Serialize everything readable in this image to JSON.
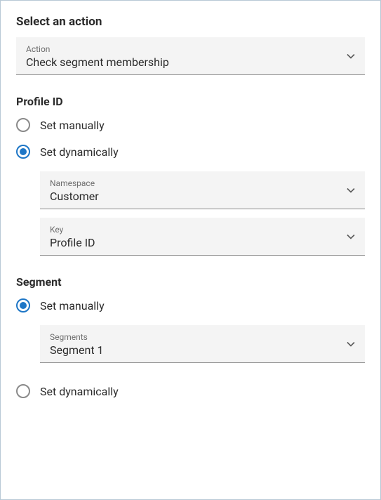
{
  "action_section": {
    "title": "Select an action",
    "select": {
      "label": "Action",
      "value": "Check segment membership"
    }
  },
  "profile_section": {
    "title": "Profile ID",
    "radio_manual": {
      "label": "Set manually",
      "selected": false
    },
    "radio_dynamic": {
      "label": "Set dynamically",
      "selected": true
    },
    "namespace_select": {
      "label": "Namespace",
      "value": "Customer"
    },
    "key_select": {
      "label": "Key",
      "value": "Profile ID"
    }
  },
  "segment_section": {
    "title": "Segment",
    "radio_manual": {
      "label": "Set manually",
      "selected": true
    },
    "segments_select": {
      "label": "Segments",
      "value": "Segment 1"
    },
    "radio_dynamic": {
      "label": "Set dynamically",
      "selected": false
    }
  }
}
